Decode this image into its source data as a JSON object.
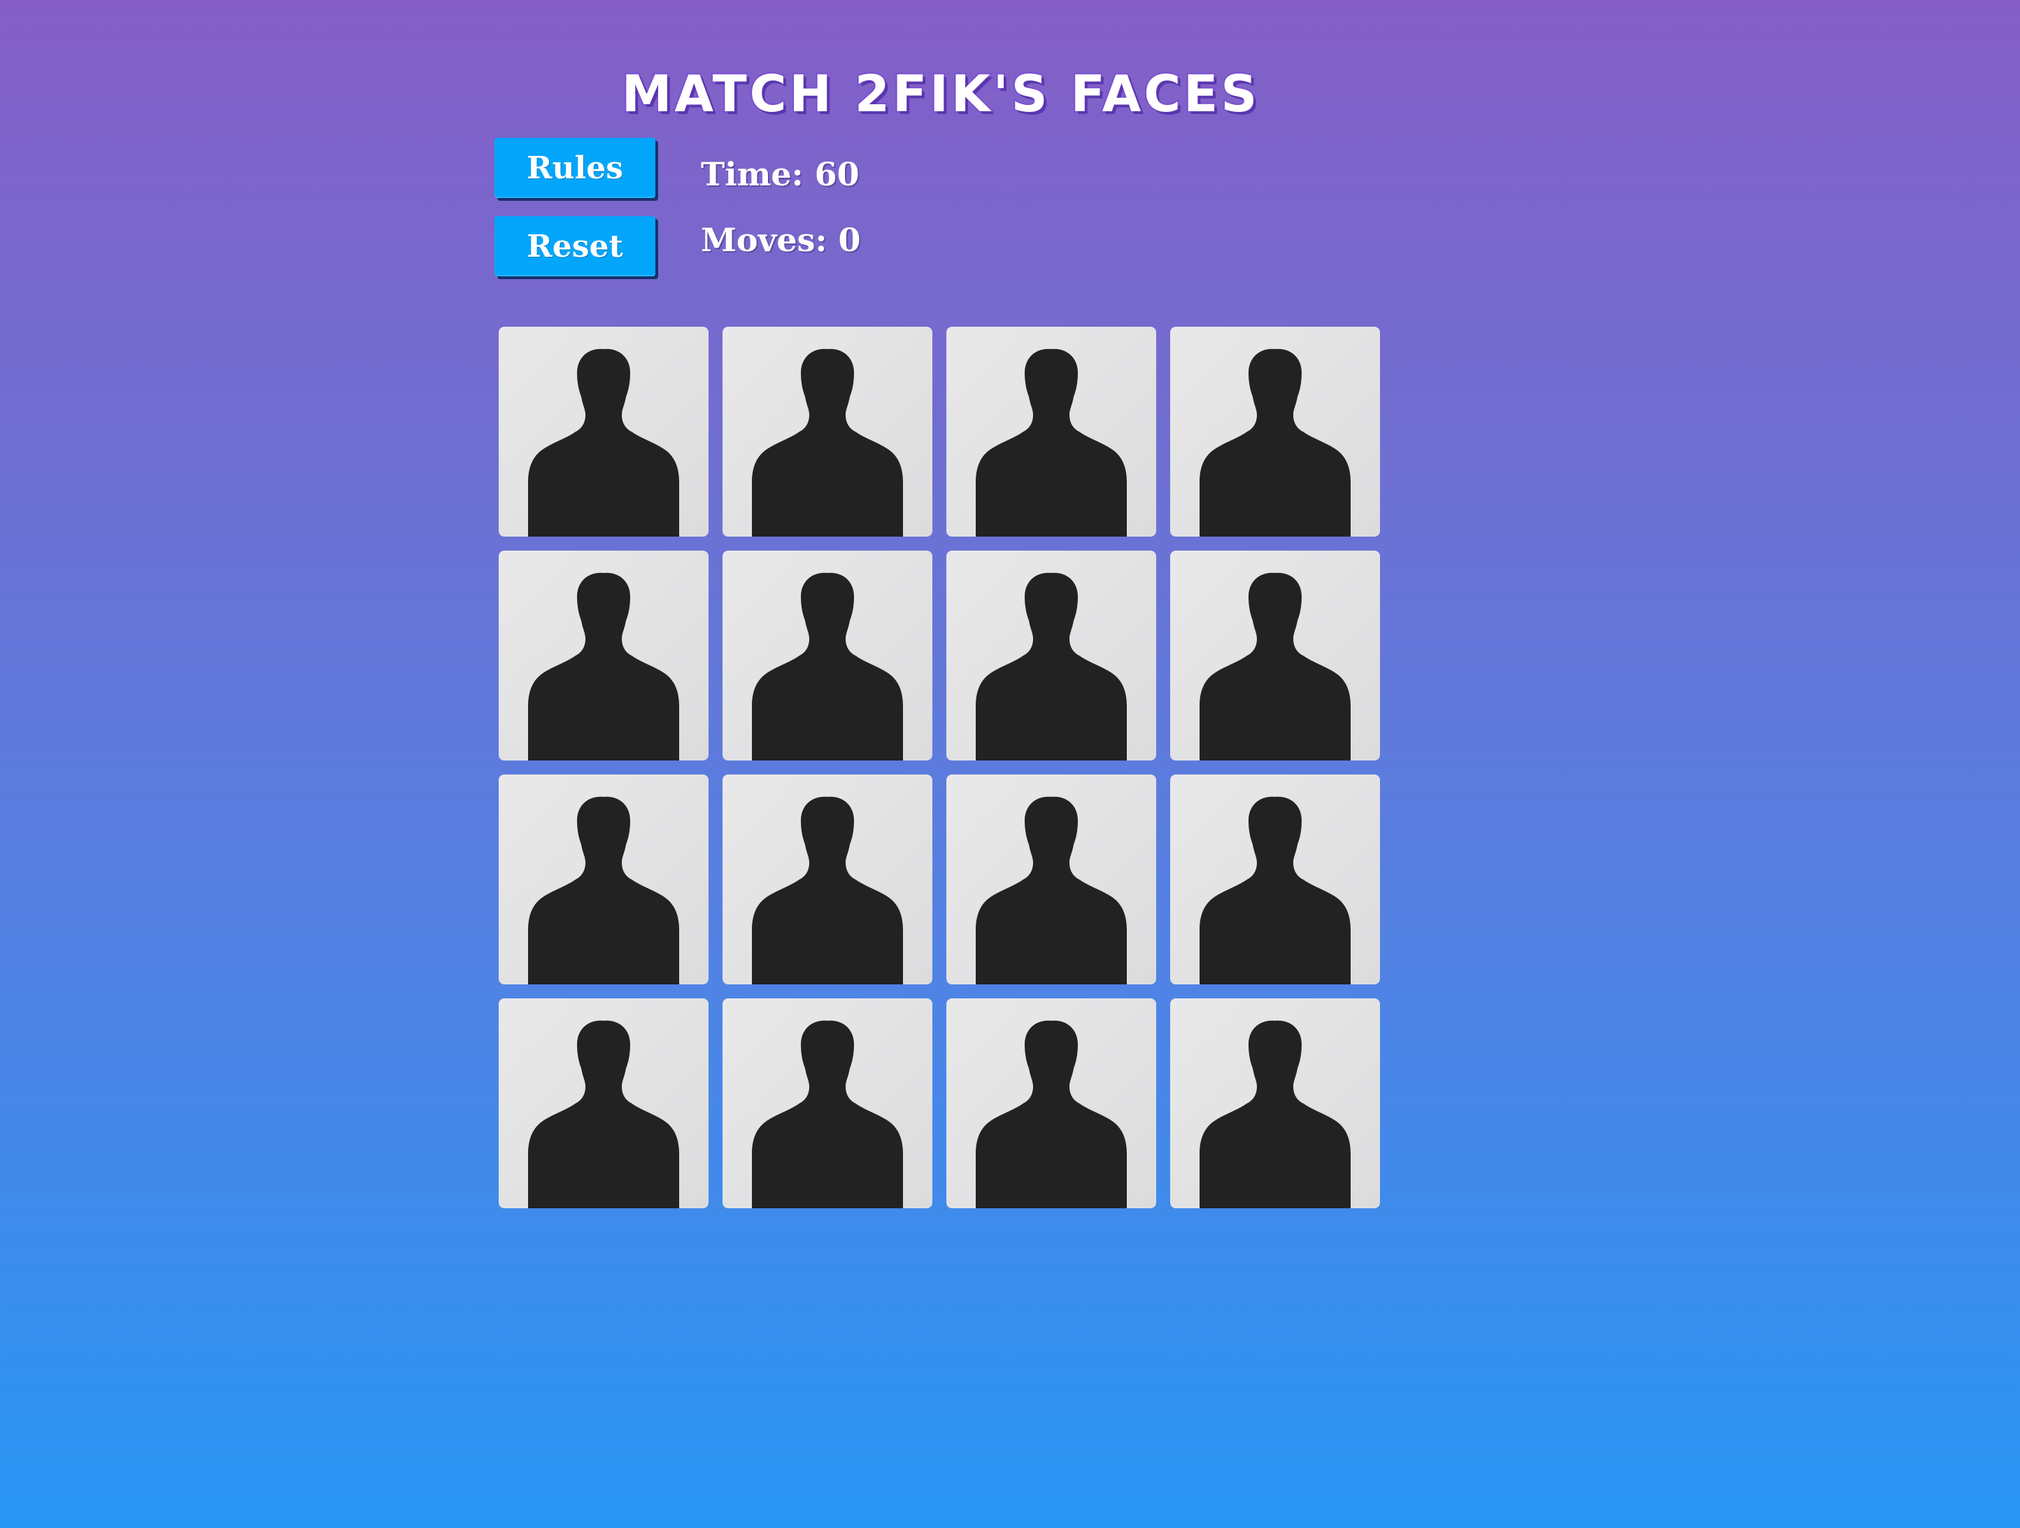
{
  "title": "Match 2fik's Faces",
  "buttons": {
    "rules": "Rules",
    "reset": "Reset"
  },
  "stats": {
    "time_label": "Time: 60",
    "moves_label": "Moves: 0",
    "time": 60,
    "moves": 0
  },
  "grid": {
    "rows": 4,
    "cols": 4,
    "cards": [
      {
        "state": "face-down",
        "icon": "silhouette-icon"
      },
      {
        "state": "face-down",
        "icon": "silhouette-icon"
      },
      {
        "state": "face-down",
        "icon": "silhouette-icon"
      },
      {
        "state": "face-down",
        "icon": "silhouette-icon"
      },
      {
        "state": "face-down",
        "icon": "silhouette-icon"
      },
      {
        "state": "face-down",
        "icon": "silhouette-icon"
      },
      {
        "state": "face-down",
        "icon": "silhouette-icon"
      },
      {
        "state": "face-down",
        "icon": "silhouette-icon"
      },
      {
        "state": "face-down",
        "icon": "silhouette-icon"
      },
      {
        "state": "face-down",
        "icon": "silhouette-icon"
      },
      {
        "state": "face-down",
        "icon": "silhouette-icon"
      },
      {
        "state": "face-down",
        "icon": "silhouette-icon"
      },
      {
        "state": "face-down",
        "icon": "silhouette-icon"
      },
      {
        "state": "face-down",
        "icon": "silhouette-icon"
      },
      {
        "state": "face-down",
        "icon": "silhouette-icon"
      },
      {
        "state": "face-down",
        "icon": "silhouette-icon"
      }
    ]
  },
  "colors": {
    "background_top": "#845ec6",
    "background_bottom": "#2896f4",
    "button": "#03a6fb",
    "card_back": "#e4e4e5",
    "silhouette": "#222222"
  }
}
